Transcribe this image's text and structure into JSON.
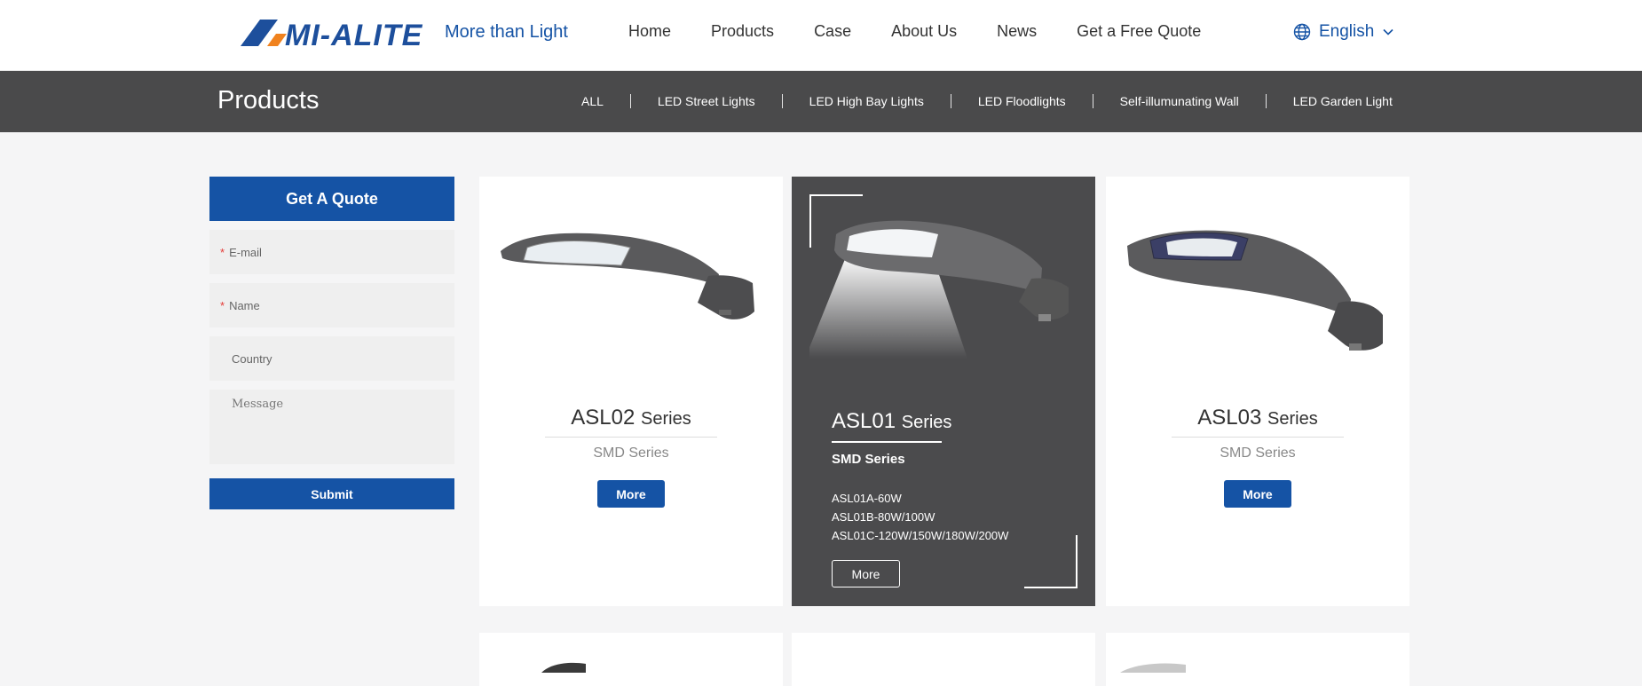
{
  "header": {
    "brand": "MI-ALITE",
    "tagline": "More than Light",
    "nav": [
      "Home",
      "Products",
      "Case",
      "About Us",
      "News",
      "Get a Free Quote"
    ],
    "language": "English"
  },
  "products_bar": {
    "title": "Products",
    "categories": [
      "ALL",
      "LED Street Lights",
      "LED High Bay Lights",
      "LED Floodlights",
      "Self-illumunating Wall",
      "LED Garden Light"
    ]
  },
  "quote_form": {
    "title": "Get A Quote",
    "fields": {
      "email": "E-mail",
      "name": "Name",
      "country": "Country",
      "message": "Message"
    },
    "required_mark": "*",
    "submit_label": "Submit"
  },
  "products": [
    {
      "model": "ASL02",
      "series": "Series",
      "subtitle": "SMD Series",
      "more_label": "More"
    },
    {
      "model": "ASL01",
      "series": "Series",
      "subtitle": "SMD Series",
      "more_label": "More",
      "specs": [
        "ASL01A-60W",
        "ASL01B-80W/100W",
        "ASL01C-120W/150W/180W/200W"
      ]
    },
    {
      "model": "ASL03",
      "series": "Series",
      "subtitle": "SMD Series",
      "more_label": "More"
    }
  ],
  "colors": {
    "brand_blue": "#1553a5",
    "brand_orange": "#f0821e",
    "dark_bar": "#4a4a4b"
  },
  "icons": {
    "language": "globe-icon",
    "dropdown": "chevron-down-icon"
  }
}
